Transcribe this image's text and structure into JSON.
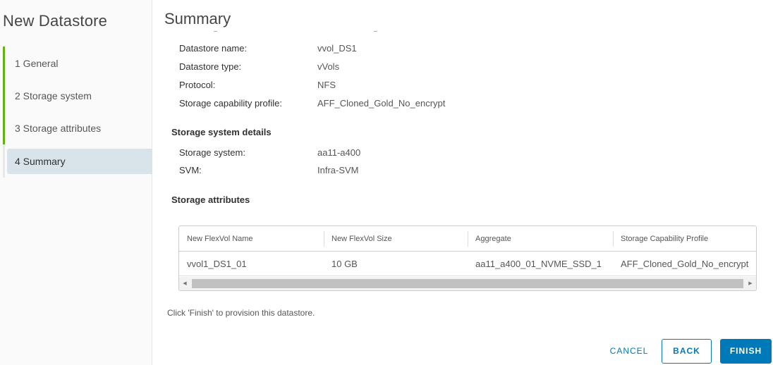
{
  "wizard": {
    "title": "New Datastore",
    "steps": [
      {
        "label": "1 General",
        "state": "done"
      },
      {
        "label": "2  Storage system",
        "state": "done"
      },
      {
        "label": "3  Storage attributes",
        "state": "done"
      },
      {
        "label": "4  Summary",
        "state": "active"
      }
    ]
  },
  "summary": {
    "title": "Summary",
    "general": [
      {
        "key": "Datastore name:",
        "value": "vvol_DS1"
      },
      {
        "key": "Datastore type:",
        "value": "vVols"
      },
      {
        "key": "Protocol:",
        "value": "NFS"
      },
      {
        "key": "Storage capability profile:",
        "value": "AFF_Cloned_Gold_No_encrypt"
      }
    ],
    "storage_system_section": "Storage system details",
    "storage_system": [
      {
        "key": "Storage system:",
        "value": "aa11-a400"
      },
      {
        "key": "SVM:",
        "value": "Infra-SVM"
      }
    ],
    "storage_attributes_section": "Storage attributes",
    "table": {
      "columns": [
        "New FlexVol Name",
        "New FlexVol Size",
        "Aggregate",
        "Storage Capability Profile"
      ],
      "rows": [
        [
          "vvol1_DS1_01",
          "10 GB",
          "aa11_a400_01_NVME_SSD_1",
          "AFF_Cloned_Gold_No_encrypt"
        ]
      ]
    },
    "hint": "Click 'Finish' to provision this datastore."
  },
  "footer": {
    "cancel_label": "CANCEL",
    "back_label": "BACK",
    "finish_label": "FINISH"
  },
  "colors": {
    "accent": "#0079b8",
    "step_done": "#60b515",
    "step_active_bg": "#d9e4ea"
  }
}
